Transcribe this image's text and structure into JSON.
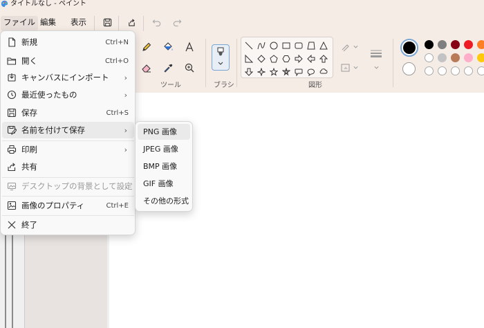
{
  "window": {
    "title": "タイトルなし - ペイント"
  },
  "menubar": {
    "tabs": [
      "ファイル",
      "編集",
      "表示"
    ]
  },
  "ribbon": {
    "tools_label": "ツール",
    "brush_label": "ブラシ",
    "shapes_label": "図形"
  },
  "file_menu": {
    "items": [
      {
        "label": "新規",
        "shortcut": "Ctrl+N",
        "icon": "new-file-icon"
      },
      {
        "label": "開く",
        "shortcut": "Ctrl+O",
        "icon": "folder-icon"
      },
      {
        "label": "キャンバスにインポート",
        "arrow": "›",
        "icon": "import-icon"
      },
      {
        "label": "最近使ったもの",
        "arrow": "›",
        "icon": "clock-icon"
      },
      {
        "label": "保存",
        "shortcut": "Ctrl+S",
        "icon": "save-icon"
      },
      {
        "label": "名前を付けて保存",
        "arrow": "›",
        "icon": "save-as-icon"
      },
      {
        "label": "印刷",
        "arrow": "›",
        "icon": "printer-icon"
      },
      {
        "label": "共有",
        "icon": "share-icon"
      },
      {
        "label": "デスクトップの背景として設定",
        "arrow": "›",
        "icon": "desktop-background-icon",
        "disabled": true
      },
      {
        "label": "画像のプロパティ",
        "shortcut": "Ctrl+E",
        "icon": "image-properties-icon"
      },
      {
        "label": "終了",
        "icon": "close-icon"
      }
    ]
  },
  "save_as_submenu": {
    "items": [
      "PNG 画像",
      "JPEG 画像",
      "BMP 画像",
      "GIF 画像",
      "その他の形式"
    ]
  },
  "colors": {
    "primary": "#000000",
    "secondary": "#ffffff",
    "accent": "#7aa6d4",
    "palette_row1": [
      "#000000",
      "#7f7f7f",
      "#880015",
      "#ed1c24",
      "#ff7f27"
    ],
    "palette_row2": [
      "#ffffff",
      "#c3c3c3",
      "#b97a57",
      "#ffaec9",
      "#ffc90e"
    ]
  }
}
